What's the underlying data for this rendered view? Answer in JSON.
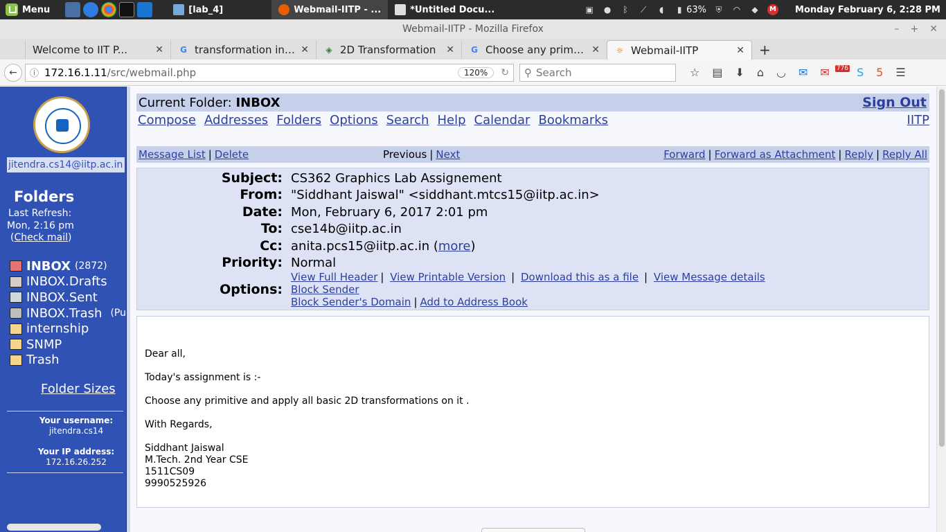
{
  "panel": {
    "menu_label": "Menu",
    "tasks": [
      {
        "label": "[lab_4]"
      },
      {
        "label": "Webmail-IITP - ..."
      },
      {
        "label": "*Untitled Docu..."
      }
    ],
    "battery": "63%",
    "clock": "Monday February  6,  2:28 PM"
  },
  "window": {
    "title": "Webmail-IITP - Mozilla Firefox"
  },
  "tabs": [
    {
      "label": "Welcome to IIT P...",
      "favicon": "",
      "active": false
    },
    {
      "label": "transformation in ...",
      "favicon": "G",
      "active": false
    },
    {
      "label": "2D Transformation",
      "favicon": "◈",
      "active": false
    },
    {
      "label": "Choose any primit...",
      "favicon": "G",
      "active": false
    },
    {
      "label": "Webmail-IITP",
      "favicon": "☼",
      "active": true
    }
  ],
  "nav": {
    "url_host": "172.16.1.11",
    "url_path": "/src/webmail.php",
    "zoom": "120%",
    "search_placeholder": "Search",
    "notif_count": "776"
  },
  "left": {
    "user_email": "jitendra.cs14@iitp.ac.in",
    "folders_title": "Folders",
    "last_refresh_label": "Last Refresh:",
    "last_refresh_time": "Mon, 2:16 pm",
    "check_mail": "Check mail",
    "folders": [
      {
        "name": "INBOX",
        "count": "(2872)",
        "bold": true
      },
      {
        "name": "INBOX.Drafts",
        "count": "",
        "bold": false
      },
      {
        "name": "INBOX.Sent",
        "count": "",
        "bold": false
      },
      {
        "name": "INBOX.Trash",
        "count": "(Pu",
        "bold": false
      },
      {
        "name": "internship",
        "count": "",
        "bold": false
      },
      {
        "name": "SNMP",
        "count": "",
        "bold": false
      },
      {
        "name": "Trash",
        "count": "",
        "bold": false
      }
    ],
    "folder_sizes": "Folder Sizes",
    "username_label": "Your username:",
    "username": "jitendra.cs14",
    "ip_label": "Your IP address:",
    "ip": "172.16.26.252"
  },
  "main": {
    "current_folder_label": "Current Folder:",
    "current_folder": "INBOX",
    "sign_out": "Sign Out",
    "menu": [
      "Compose",
      "Addresses",
      "Folders",
      "Options",
      "Search",
      "Help",
      "Calendar",
      "Bookmarks"
    ],
    "iitp": "IITP",
    "msg_list": "Message List",
    "delete": "Delete",
    "previous": "Previous",
    "next": "Next",
    "forward": "Forward",
    "forward_attach": "Forward as Attachment",
    "reply": "Reply",
    "reply_all": "Reply All",
    "headers": {
      "subject_label": "Subject:",
      "subject": "CS362 Graphics Lab Assignement",
      "from_label": "From:",
      "from": "\"Siddhant Jaiswal\" <siddhant.mtcs15@iitp.ac.in>",
      "date_label": "Date:",
      "date": "Mon, February 6, 2017 2:01 pm",
      "to_label": "To:",
      "to": "cse14b@iitp.ac.in",
      "cc_label": "Cc:",
      "cc": "anita.pcs15@iitp.ac.in",
      "more": "more",
      "priority_label": "Priority:",
      "priority": "Normal",
      "options_label": "Options:",
      "view_full_header": "View Full Header",
      "view_printable": "View Printable Version",
      "download_file": "Download this as a file",
      "view_details": "View Message details",
      "block_sender": "Block Sender",
      "block_domain": "Block Sender's Domain",
      "add_address": "Add to Address Book"
    },
    "body": {
      "greeting": "Dear all,",
      "line1": "Today's assignment is :-",
      "line2": "Choose any primitive and apply all basic 2D transformations on it .",
      "regards": "With Regards,",
      "sig": [
        "Siddhant Jaiswal",
        "M.Tech. 2nd Year CSE",
        "1511CS09",
        "9990525926"
      ]
    }
  }
}
